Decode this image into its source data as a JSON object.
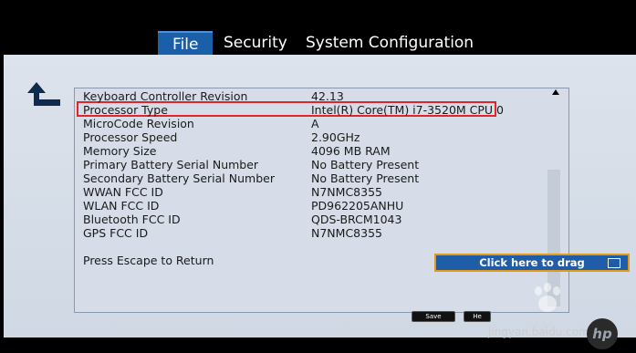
{
  "tabs": [
    {
      "label": "File",
      "active": true
    },
    {
      "label": "Security",
      "active": false
    },
    {
      "label": "System Configuration",
      "active": false
    }
  ],
  "info_rows": [
    {
      "label": "Keyboard Controller Revision",
      "value": "42.13"
    },
    {
      "label": "Processor Type",
      "value": "Intel(R) Core(TM) i7-3520M CPU 0"
    },
    {
      "label": "MicroCode Revision",
      "value": "A"
    },
    {
      "label": "Processor Speed",
      "value": "2.90GHz"
    },
    {
      "label": "Memory Size",
      "value": "4096 MB RAM"
    },
    {
      "label": "Primary Battery Serial Number",
      "value": "No Battery Present"
    },
    {
      "label": "Secondary Battery Serial Number",
      "value": "No Battery Present"
    },
    {
      "label": "WWAN FCC ID",
      "value": "N7NMC8355"
    },
    {
      "label": "WLAN FCC ID",
      "value": "PD962205ANHU"
    },
    {
      "label": "Bluetooth FCC ID",
      "value": "QDS-BRCM1043"
    },
    {
      "label": "GPS FCC ID",
      "value": "N7NMC8355"
    }
  ],
  "escape_hint": "Press Escape to Return",
  "drag_box": {
    "label": "Click here to drag"
  },
  "buttons": {
    "save": "Save",
    "help": "He"
  },
  "watermark": {
    "text": "jingyan.baidu.com"
  },
  "logo": {
    "text": "hp"
  },
  "colors": {
    "tab_active": "#1b5fa8",
    "highlight": "#e0262a",
    "drag_border": "#e39a1a"
  }
}
